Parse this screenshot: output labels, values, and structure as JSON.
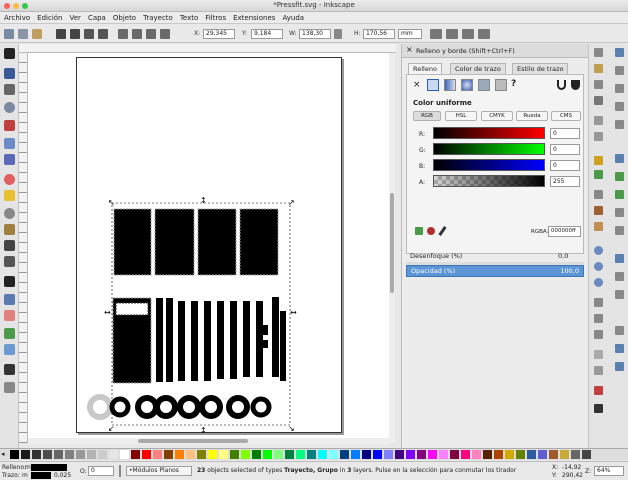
{
  "window": {
    "title": "*Pressfit.svg - Inkscape"
  },
  "menu": [
    "Archivo",
    "Edición",
    "Ver",
    "Capa",
    "Objeto",
    "Trayecto",
    "Texto",
    "Filtros",
    "Extensiones",
    "Ayuda"
  ],
  "toolbar": {
    "x_label": "X:",
    "x_value": "29,345",
    "y_label": "Y:",
    "y_value": "9,184",
    "w_label": "W:",
    "w_value": "138,30",
    "h_label": "H:",
    "h_value": "170,56",
    "unit": "mm"
  },
  "panel": {
    "title": "Relleno y borde (Shift+Ctrl+F)",
    "tabs": [
      "Relleno",
      "Color de trazo",
      "Estilo de trazo"
    ],
    "unset_symbol": "×",
    "unknown_symbol": "?",
    "heading": "Color uniforme",
    "modes": [
      "RGB",
      "HSL",
      "CMYK",
      "Rueda",
      "CMS"
    ],
    "channels": [
      {
        "label": "R:",
        "value": "0",
        "color": "#e00000"
      },
      {
        "label": "G:",
        "value": "0",
        "color": "#00e000"
      },
      {
        "label": "B:",
        "value": "0",
        "color": "#0000e0"
      },
      {
        "label": "A:",
        "value": "255",
        "color": "#000000"
      }
    ],
    "rgba_label": "RGBA:",
    "rgba_value": "000000ff",
    "blur_label": "Desenfoque (%)",
    "blur_value": "0,0",
    "opacity_label": "Opacidad (%)",
    "opacity_value": "100,0"
  },
  "status": {
    "fill_label": "Relleno:",
    "fill_mode": "m",
    "stroke_label": "Trazo:",
    "stroke_mode": "m",
    "stroke_width": "0,025",
    "o_label": "O:",
    "o_value": "0",
    "layer": "•Módulos Planos",
    "message_count": "23",
    "message_a": " objects selected of types ",
    "message_types": "Trayecto, Grupo",
    "message_b": " in ",
    "message_layers": "3",
    "message_c": " layers. Pulse en la selección para conmutar los tirador",
    "x_label": "X:",
    "x_value": "-14,92",
    "y_label": "Y:",
    "y_value": "290,42",
    "z_label": "Z:",
    "zoom": "64%"
  }
}
